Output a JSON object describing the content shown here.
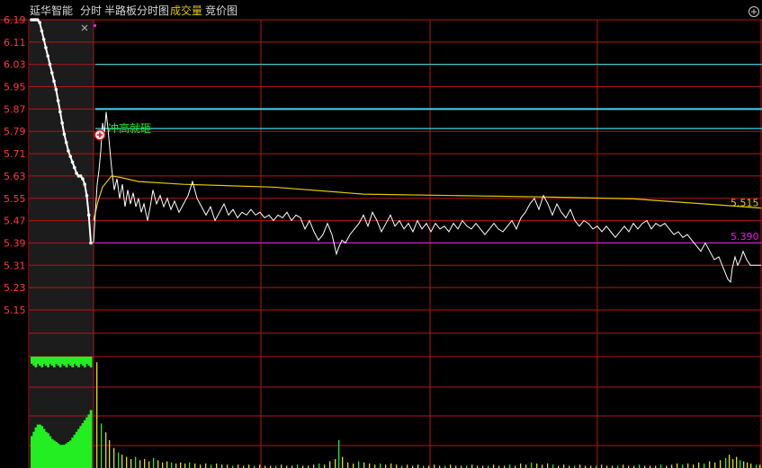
{
  "header": {
    "stock_name": "延华智能",
    "tab_intraday": "分时",
    "tab_half_board": "半路板分时图",
    "tab_volume": "成交量",
    "tab_auction": "竞价图"
  },
  "colors": {
    "grid": "#b01818",
    "axis_label": "#ff3b3b",
    "price_line": "#ffffff",
    "avg_line": "#e6c800",
    "cyan_line": "#3ed8e6",
    "magenta_line": "#e020e0",
    "vol_up": "#e6e000",
    "vol_down": "#22ee22",
    "annotation": "#22ee22",
    "auction_bg": "#1c1c1c"
  },
  "chart_data": {
    "type": "line",
    "y_axis_ticks": [
      "6.19",
      "6.11",
      "6.03",
      "5.95",
      "5.87",
      "5.79",
      "5.71",
      "5.63",
      "5.55",
      "5.47",
      "5.39",
      "5.31",
      "5.23",
      "5.15"
    ],
    "ylim": [
      5.15,
      6.19
    ],
    "auction_series": [
      6.19,
      6.19,
      6.19,
      6.19,
      6.18,
      6.15,
      6.12,
      6.09,
      6.06,
      6.03,
      6.0,
      5.97,
      5.94,
      5.9,
      5.86,
      5.82,
      5.78,
      5.75,
      5.72,
      5.7,
      5.68,
      5.66,
      5.64,
      5.63,
      5.63,
      5.62,
      5.6,
      5.56,
      5.49,
      5.39
    ],
    "price_series": [
      {
        "t": 0,
        "p": 5.39
      },
      {
        "t": 2,
        "p": 5.5
      },
      {
        "t": 4,
        "p": 5.6
      },
      {
        "t": 6,
        "p": 5.65
      },
      {
        "t": 8,
        "p": 5.72
      },
      {
        "t": 10,
        "p": 5.82
      },
      {
        "t": 12,
        "p": 5.78
      },
      {
        "t": 14,
        "p": 5.86
      },
      {
        "t": 16,
        "p": 5.8
      },
      {
        "t": 18,
        "p": 5.73
      },
      {
        "t": 20,
        "p": 5.66
      },
      {
        "t": 23,
        "p": 5.58
      },
      {
        "t": 26,
        "p": 5.62
      },
      {
        "t": 29,
        "p": 5.55
      },
      {
        "t": 32,
        "p": 5.6
      },
      {
        "t": 35,
        "p": 5.52
      },
      {
        "t": 38,
        "p": 5.58
      },
      {
        "t": 41,
        "p": 5.53
      },
      {
        "t": 44,
        "p": 5.57
      },
      {
        "t": 47,
        "p": 5.52
      },
      {
        "t": 50,
        "p": 5.55
      },
      {
        "t": 53,
        "p": 5.5
      },
      {
        "t": 56,
        "p": 5.53
      },
      {
        "t": 60,
        "p": 5.47
      },
      {
        "t": 63,
        "p": 5.52
      },
      {
        "t": 66,
        "p": 5.58
      },
      {
        "t": 70,
        "p": 5.53
      },
      {
        "t": 74,
        "p": 5.56
      },
      {
        "t": 78,
        "p": 5.52
      },
      {
        "t": 82,
        "p": 5.55
      },
      {
        "t": 86,
        "p": 5.51
      },
      {
        "t": 90,
        "p": 5.54
      },
      {
        "t": 95,
        "p": 5.5
      },
      {
        "t": 100,
        "p": 5.53
      },
      {
        "t": 105,
        "p": 5.56
      },
      {
        "t": 110,
        "p": 5.61
      },
      {
        "t": 115,
        "p": 5.55
      },
      {
        "t": 120,
        "p": 5.52
      },
      {
        "t": 125,
        "p": 5.49
      },
      {
        "t": 130,
        "p": 5.52
      },
      {
        "t": 135,
        "p": 5.47
      },
      {
        "t": 140,
        "p": 5.5
      },
      {
        "t": 145,
        "p": 5.53
      },
      {
        "t": 150,
        "p": 5.49
      },
      {
        "t": 155,
        "p": 5.51
      },
      {
        "t": 160,
        "p": 5.48
      },
      {
        "t": 165,
        "p": 5.5
      },
      {
        "t": 170,
        "p": 5.49
      },
      {
        "t": 175,
        "p": 5.51
      },
      {
        "t": 180,
        "p": 5.49
      },
      {
        "t": 185,
        "p": 5.5
      },
      {
        "t": 190,
        "p": 5.48
      },
      {
        "t": 195,
        "p": 5.49
      },
      {
        "t": 200,
        "p": 5.47
      },
      {
        "t": 205,
        "p": 5.49
      },
      {
        "t": 210,
        "p": 5.48
      },
      {
        "t": 215,
        "p": 5.5
      },
      {
        "t": 220,
        "p": 5.47
      },
      {
        "t": 225,
        "p": 5.49
      },
      {
        "t": 230,
        "p": 5.48
      },
      {
        "t": 235,
        "p": 5.44
      },
      {
        "t": 240,
        "p": 5.47
      },
      {
        "t": 245,
        "p": 5.43
      },
      {
        "t": 250,
        "p": 5.4
      },
      {
        "t": 255,
        "p": 5.42
      },
      {
        "t": 260,
        "p": 5.46
      },
      {
        "t": 265,
        "p": 5.42
      },
      {
        "t": 270,
        "p": 5.35
      },
      {
        "t": 272,
        "p": 5.37
      },
      {
        "t": 276,
        "p": 5.4
      },
      {
        "t": 280,
        "p": 5.39
      },
      {
        "t": 285,
        "p": 5.42
      },
      {
        "t": 290,
        "p": 5.44
      },
      {
        "t": 295,
        "p": 5.46
      },
      {
        "t": 300,
        "p": 5.49
      },
      {
        "t": 305,
        "p": 5.45
      },
      {
        "t": 310,
        "p": 5.5
      },
      {
        "t": 315,
        "p": 5.47
      },
      {
        "t": 320,
        "p": 5.43
      },
      {
        "t": 325,
        "p": 5.46
      },
      {
        "t": 330,
        "p": 5.49
      },
      {
        "t": 335,
        "p": 5.45
      },
      {
        "t": 340,
        "p": 5.47
      },
      {
        "t": 345,
        "p": 5.44
      },
      {
        "t": 350,
        "p": 5.46
      },
      {
        "t": 355,
        "p": 5.43
      },
      {
        "t": 360,
        "p": 5.47
      },
      {
        "t": 365,
        "p": 5.44
      },
      {
        "t": 370,
        "p": 5.46
      },
      {
        "t": 375,
        "p": 5.43
      },
      {
        "t": 380,
        "p": 5.46
      },
      {
        "t": 385,
        "p": 5.44
      },
      {
        "t": 390,
        "p": 5.45
      },
      {
        "t": 395,
        "p": 5.43
      },
      {
        "t": 400,
        "p": 5.46
      },
      {
        "t": 405,
        "p": 5.44
      },
      {
        "t": 410,
        "p": 5.47
      },
      {
        "t": 415,
        "p": 5.45
      },
      {
        "t": 420,
        "p": 5.44
      },
      {
        "t": 425,
        "p": 5.46
      },
      {
        "t": 430,
        "p": 5.44
      },
      {
        "t": 435,
        "p": 5.42
      },
      {
        "t": 440,
        "p": 5.44
      },
      {
        "t": 445,
        "p": 5.46
      },
      {
        "t": 450,
        "p": 5.44
      },
      {
        "t": 455,
        "p": 5.43
      },
      {
        "t": 460,
        "p": 5.45
      },
      {
        "t": 465,
        "p": 5.47
      },
      {
        "t": 470,
        "p": 5.44
      },
      {
        "t": 475,
        "p": 5.48
      },
      {
        "t": 480,
        "p": 5.5
      },
      {
        "t": 485,
        "p": 5.53
      },
      {
        "t": 490,
        "p": 5.55
      },
      {
        "t": 495,
        "p": 5.51
      },
      {
        "t": 500,
        "p": 5.56
      },
      {
        "t": 505,
        "p": 5.53
      },
      {
        "t": 510,
        "p": 5.49
      },
      {
        "t": 515,
        "p": 5.53
      },
      {
        "t": 520,
        "p": 5.5
      },
      {
        "t": 525,
        "p": 5.48
      },
      {
        "t": 530,
        "p": 5.51
      },
      {
        "t": 535,
        "p": 5.47
      },
      {
        "t": 540,
        "p": 5.45
      },
      {
        "t": 545,
        "p": 5.47
      },
      {
        "t": 550,
        "p": 5.46
      },
      {
        "t": 555,
        "p": 5.44
      },
      {
        "t": 560,
        "p": 5.45
      },
      {
        "t": 565,
        "p": 5.43
      },
      {
        "t": 570,
        "p": 5.45
      },
      {
        "t": 575,
        "p": 5.43
      },
      {
        "t": 580,
        "p": 5.41
      },
      {
        "t": 585,
        "p": 5.43
      },
      {
        "t": 590,
        "p": 5.45
      },
      {
        "t": 595,
        "p": 5.43
      },
      {
        "t": 600,
        "p": 5.46
      },
      {
        "t": 605,
        "p": 5.44
      },
      {
        "t": 610,
        "p": 5.46
      },
      {
        "t": 615,
        "p": 5.47
      },
      {
        "t": 620,
        "p": 5.44
      },
      {
        "t": 625,
        "p": 5.46
      },
      {
        "t": 630,
        "p": 5.45
      },
      {
        "t": 635,
        "p": 5.46
      },
      {
        "t": 640,
        "p": 5.44
      },
      {
        "t": 645,
        "p": 5.42
      },
      {
        "t": 650,
        "p": 5.43
      },
      {
        "t": 655,
        "p": 5.41
      },
      {
        "t": 660,
        "p": 5.42
      },
      {
        "t": 665,
        "p": 5.4
      },
      {
        "t": 670,
        "p": 5.38
      },
      {
        "t": 675,
        "p": 5.36
      },
      {
        "t": 680,
        "p": 5.39
      },
      {
        "t": 685,
        "p": 5.36
      },
      {
        "t": 690,
        "p": 5.33
      },
      {
        "t": 695,
        "p": 5.34
      },
      {
        "t": 700,
        "p": 5.3
      },
      {
        "t": 705,
        "p": 5.26
      },
      {
        "t": 708,
        "p": 5.25
      },
      {
        "t": 710,
        "p": 5.3
      },
      {
        "t": 713,
        "p": 5.34
      },
      {
        "t": 716,
        "p": 5.31
      },
      {
        "t": 719,
        "p": 5.33
      },
      {
        "t": 722,
        "p": 5.36
      },
      {
        "t": 726,
        "p": 5.33
      },
      {
        "t": 730,
        "p": 5.31
      },
      {
        "t": 742,
        "p": 5.31
      }
    ],
    "avg_series": [
      {
        "t": 0,
        "p": 5.47
      },
      {
        "t": 5,
        "p": 5.54
      },
      {
        "t": 10,
        "p": 5.59
      },
      {
        "t": 20,
        "p": 5.63
      },
      {
        "t": 30,
        "p": 5.625
      },
      {
        "t": 50,
        "p": 5.61
      },
      {
        "t": 100,
        "p": 5.6
      },
      {
        "t": 200,
        "p": 5.59
      },
      {
        "t": 300,
        "p": 5.565
      },
      {
        "t": 400,
        "p": 5.56
      },
      {
        "t": 500,
        "p": 5.555
      },
      {
        "t": 600,
        "p": 5.548
      },
      {
        "t": 700,
        "p": 5.525
      },
      {
        "t": 742,
        "p": 5.515
      }
    ],
    "reference_lines": [
      {
        "color_key": "cyan_line",
        "value": 6.03
      },
      {
        "color_key": "cyan_line",
        "value": 5.87
      },
      {
        "color_key": "cyan_line",
        "value": 5.8
      },
      {
        "color_key": "magenta_line",
        "value": 5.39
      }
    ],
    "auction_volume": [
      0.22,
      0.25,
      0.28,
      0.3,
      0.3,
      0.29,
      0.27,
      0.25,
      0.24,
      0.22,
      0.2,
      0.19,
      0.18,
      0.17,
      0.16,
      0.16,
      0.16,
      0.17,
      0.18,
      0.19,
      0.21,
      0.23,
      0.25,
      0.27,
      0.29,
      0.31,
      0.33,
      0.35,
      0.37,
      0.4
    ],
    "volume_bars": [
      {
        "t": 3,
        "v": 0.95
      },
      {
        "t": 8,
        "v": 0.4
      },
      {
        "t": 13,
        "v": 0.32
      },
      {
        "t": 17,
        "v": 0.25
      },
      {
        "t": 22,
        "v": 0.18
      },
      {
        "t": 27,
        "v": 0.14
      },
      {
        "t": 31,
        "v": 0.12
      },
      {
        "t": 36,
        "v": 0.1
      },
      {
        "t": 41,
        "v": 0.08
      },
      {
        "t": 46,
        "v": 0.1
      },
      {
        "t": 51,
        "v": 0.07
      },
      {
        "t": 56,
        "v": 0.08
      },
      {
        "t": 61,
        "v": 0.06
      },
      {
        "t": 66,
        "v": 0.09
      },
      {
        "t": 71,
        "v": 0.07
      },
      {
        "t": 76,
        "v": 0.05
      },
      {
        "t": 81,
        "v": 0.06
      },
      {
        "t": 86,
        "v": 0.05
      },
      {
        "t": 91,
        "v": 0.04
      },
      {
        "t": 96,
        "v": 0.05
      },
      {
        "t": 101,
        "v": 0.04
      },
      {
        "t": 106,
        "v": 0.05
      },
      {
        "t": 112,
        "v": 0.04
      },
      {
        "t": 118,
        "v": 0.03
      },
      {
        "t": 124,
        "v": 0.04
      },
      {
        "t": 130,
        "v": 0.03
      },
      {
        "t": 136,
        "v": 0.04
      },
      {
        "t": 142,
        "v": 0.03
      },
      {
        "t": 148,
        "v": 0.03
      },
      {
        "t": 154,
        "v": 0.02
      },
      {
        "t": 160,
        "v": 0.03
      },
      {
        "t": 166,
        "v": 0.02
      },
      {
        "t": 172,
        "v": 0.03
      },
      {
        "t": 178,
        "v": 0.02
      },
      {
        "t": 184,
        "v": 0.03
      },
      {
        "t": 190,
        "v": 0.02
      },
      {
        "t": 196,
        "v": 0.02
      },
      {
        "t": 202,
        "v": 0.02
      },
      {
        "t": 208,
        "v": 0.03
      },
      {
        "t": 214,
        "v": 0.02
      },
      {
        "t": 220,
        "v": 0.02
      },
      {
        "t": 226,
        "v": 0.03
      },
      {
        "t": 232,
        "v": 0.02
      },
      {
        "t": 238,
        "v": 0.02
      },
      {
        "t": 244,
        "v": 0.03
      },
      {
        "t": 250,
        "v": 0.04
      },
      {
        "t": 256,
        "v": 0.03
      },
      {
        "t": 262,
        "v": 0.06
      },
      {
        "t": 268,
        "v": 0.08
      },
      {
        "t": 272,
        "v": 0.25
      },
      {
        "t": 276,
        "v": 0.1
      },
      {
        "t": 282,
        "v": 0.05
      },
      {
        "t": 288,
        "v": 0.04
      },
      {
        "t": 294,
        "v": 0.06
      },
      {
        "t": 300,
        "v": 0.05
      },
      {
        "t": 306,
        "v": 0.04
      },
      {
        "t": 312,
        "v": 0.03
      },
      {
        "t": 318,
        "v": 0.04
      },
      {
        "t": 324,
        "v": 0.03
      },
      {
        "t": 330,
        "v": 0.04
      },
      {
        "t": 336,
        "v": 0.03
      },
      {
        "t": 342,
        "v": 0.02
      },
      {
        "t": 348,
        "v": 0.03
      },
      {
        "t": 354,
        "v": 0.02
      },
      {
        "t": 360,
        "v": 0.03
      },
      {
        "t": 366,
        "v": 0.02
      },
      {
        "t": 372,
        "v": 0.02
      },
      {
        "t": 378,
        "v": 0.03
      },
      {
        "t": 384,
        "v": 0.02
      },
      {
        "t": 390,
        "v": 0.02
      },
      {
        "t": 396,
        "v": 0.03
      },
      {
        "t": 402,
        "v": 0.02
      },
      {
        "t": 408,
        "v": 0.02
      },
      {
        "t": 414,
        "v": 0.02
      },
      {
        "t": 420,
        "v": 0.03
      },
      {
        "t": 426,
        "v": 0.02
      },
      {
        "t": 432,
        "v": 0.02
      },
      {
        "t": 438,
        "v": 0.02
      },
      {
        "t": 444,
        "v": 0.03
      },
      {
        "t": 450,
        "v": 0.02
      },
      {
        "t": 456,
        "v": 0.02
      },
      {
        "t": 462,
        "v": 0.03
      },
      {
        "t": 468,
        "v": 0.02
      },
      {
        "t": 474,
        "v": 0.04
      },
      {
        "t": 480,
        "v": 0.03
      },
      {
        "t": 486,
        "v": 0.05
      },
      {
        "t": 492,
        "v": 0.04
      },
      {
        "t": 498,
        "v": 0.03
      },
      {
        "t": 504,
        "v": 0.04
      },
      {
        "t": 510,
        "v": 0.03
      },
      {
        "t": 516,
        "v": 0.02
      },
      {
        "t": 522,
        "v": 0.03
      },
      {
        "t": 528,
        "v": 0.02
      },
      {
        "t": 534,
        "v": 0.02
      },
      {
        "t": 540,
        "v": 0.03
      },
      {
        "t": 546,
        "v": 0.02
      },
      {
        "t": 552,
        "v": 0.02
      },
      {
        "t": 558,
        "v": 0.02
      },
      {
        "t": 564,
        "v": 0.03
      },
      {
        "t": 570,
        "v": 0.02
      },
      {
        "t": 576,
        "v": 0.02
      },
      {
        "t": 582,
        "v": 0.02
      },
      {
        "t": 588,
        "v": 0.03
      },
      {
        "t": 594,
        "v": 0.02
      },
      {
        "t": 600,
        "v": 0.02
      },
      {
        "t": 606,
        "v": 0.03
      },
      {
        "t": 612,
        "v": 0.02
      },
      {
        "t": 618,
        "v": 0.02
      },
      {
        "t": 624,
        "v": 0.02
      },
      {
        "t": 630,
        "v": 0.03
      },
      {
        "t": 636,
        "v": 0.02
      },
      {
        "t": 642,
        "v": 0.03
      },
      {
        "t": 648,
        "v": 0.04
      },
      {
        "t": 654,
        "v": 0.03
      },
      {
        "t": 660,
        "v": 0.04
      },
      {
        "t": 666,
        "v": 0.03
      },
      {
        "t": 672,
        "v": 0.05
      },
      {
        "t": 678,
        "v": 0.04
      },
      {
        "t": 684,
        "v": 0.06
      },
      {
        "t": 690,
        "v": 0.05
      },
      {
        "t": 696,
        "v": 0.07
      },
      {
        "t": 702,
        "v": 0.09
      },
      {
        "t": 706,
        "v": 0.12
      },
      {
        "t": 710,
        "v": 0.08
      },
      {
        "t": 714,
        "v": 0.1
      },
      {
        "t": 718,
        "v": 0.07
      },
      {
        "t": 722,
        "v": 0.06
      },
      {
        "t": 726,
        "v": 0.05
      },
      {
        "t": 730,
        "v": 0.04
      },
      {
        "t": 736,
        "v": 0.03
      },
      {
        "t": 740,
        "v": 0.03
      }
    ],
    "value_labels": [
      {
        "text": "5.515",
        "price": 5.515,
        "color_key": "avg_line"
      },
      {
        "text": "5.390",
        "price": 5.395,
        "color_key": "magenta_line"
      }
    ],
    "annotation": {
      "text": "冲高就砸",
      "price": 5.79
    }
  }
}
